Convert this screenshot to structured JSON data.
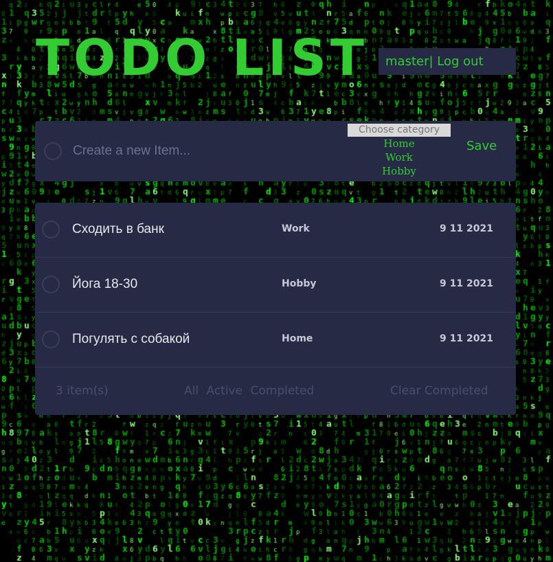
{
  "header": {
    "title": "TODO LIST",
    "user_name": "master|",
    "logout_label": "Log out"
  },
  "create": {
    "placeholder": "Create a new Item...",
    "category_placeholder": "Choose category",
    "categories": [
      "Home",
      "Work",
      "Hobby"
    ],
    "save_label": "Save"
  },
  "items": [
    {
      "text": "Сходить в банк",
      "category": "Work",
      "date": "9 11 2021"
    },
    {
      "text": "Йога 18-30",
      "category": "Hobby",
      "date": "9 11 2021"
    },
    {
      "text": "Погулять с собакой",
      "category": "Home",
      "date": "9 11 2021"
    }
  ],
  "footer": {
    "count": "3 item(s)",
    "filter_all": "All",
    "filter_active": "Active",
    "filter_completed": "Completed",
    "clear_label": "Clear Completed"
  },
  "colors": {
    "accent": "#33cc33",
    "card": "#262a44",
    "background": "#000000"
  }
}
